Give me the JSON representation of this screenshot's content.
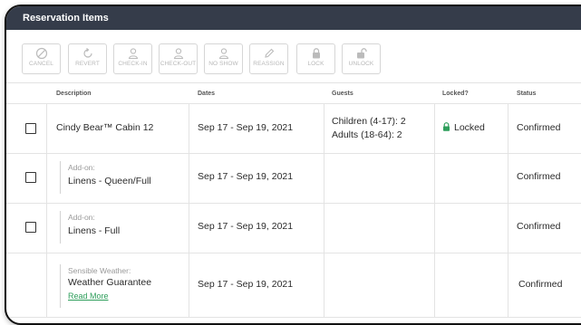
{
  "panel": {
    "title": "Reservation Items"
  },
  "toolbar": {
    "buttons": [
      {
        "label": "CANCEL",
        "icon": "cancel-icon"
      },
      {
        "label": "REVERT",
        "icon": "revert-icon"
      },
      {
        "label": "CHECK-IN",
        "icon": "person-icon"
      },
      {
        "label": "CHECK-OUT",
        "icon": "person-icon"
      },
      {
        "label": "NO SHOW",
        "icon": "person-icon"
      },
      {
        "label": "REASSIGN",
        "icon": "pencil-icon"
      },
      {
        "label": "LOCK",
        "icon": "lock-icon"
      },
      {
        "label": "UNLOCK",
        "icon": "unlock-icon"
      }
    ]
  },
  "columns": {
    "description": "Description",
    "dates": "Dates",
    "guests": "Guests",
    "locked": "Locked?",
    "status": "Status"
  },
  "rows": [
    {
      "description": "Cindy Bear™ Cabin 12",
      "dates": "Sep 17 - Sep 19, 2021",
      "guests_line1": "Children (4-17): 2",
      "guests_line2": "Adults (18-64): 2",
      "locked": "Locked",
      "status": "Confirmed"
    },
    {
      "addon_label": "Add-on:",
      "description": "Linens - Queen/Full",
      "dates": "Sep 17 - Sep 19, 2021",
      "status": "Confirmed"
    },
    {
      "addon_label": "Add-on:",
      "description": "Linens - Full",
      "dates": "Sep 17 - Sep 19, 2021",
      "status": "Confirmed"
    },
    {
      "addon_label": "Sensible Weather:",
      "description": "Weather Guarantee",
      "link": "Read More",
      "dates": "Sep 17 - Sep 19, 2021",
      "status": "Confirmed"
    }
  ],
  "colors": {
    "header_bg": "#353c4a",
    "locked_green": "#2e9e5b",
    "link_green": "#2e9e5b"
  }
}
